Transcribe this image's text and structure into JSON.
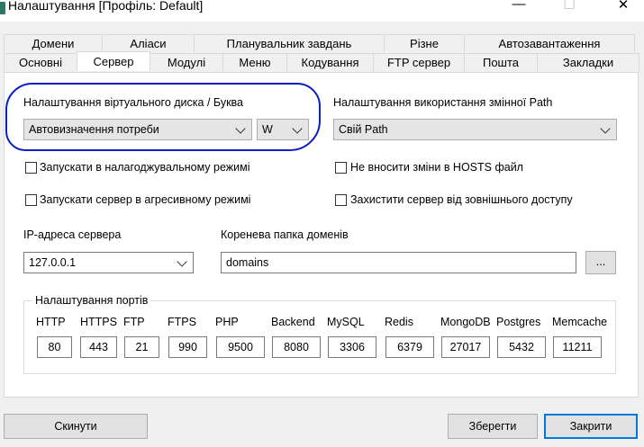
{
  "window": {
    "title": "Налаштування [Профіль: Default]",
    "minimize": "—",
    "maximize": "☐",
    "close": "✕"
  },
  "tabs_row1": [
    "Домени",
    "Аліаси",
    "Планувальник завдань",
    "Різне",
    "Автозавантаження"
  ],
  "tabs_row2": [
    "Основні",
    "Сервер",
    "Модулі",
    "Меню",
    "Кодування",
    "FTP сервер",
    "Пошта",
    "Закладки"
  ],
  "active_tab": "Сервер",
  "vdisk": {
    "label": "Налаштування віртуального диска / Буква",
    "value": "Автовизначення потреби",
    "letter": "W"
  },
  "path": {
    "label": "Налаштування використання змінної Path",
    "value": "Свій Path"
  },
  "checkboxes": {
    "debug": "Запускати в налагоджувальному режимі",
    "hosts": "Не вносити зміни в HOSTS файл",
    "aggressive": "Запускати сервер в агресивному режимі",
    "protect": "Захистити сервер від зовнішнього доступу"
  },
  "ip": {
    "label": "IP-адреса сервера",
    "value": "127.0.0.1"
  },
  "root": {
    "label": "Коренева папка доменів",
    "value": "domains",
    "browse": "..."
  },
  "ports": {
    "title": "Налаштування портів",
    "labels": [
      "HTTP",
      "HTTPS",
      "FTP",
      "FTPS",
      "PHP",
      "Backend",
      "MySQL",
      "Redis",
      "MongoDB",
      "Postgres",
      "Memcache"
    ],
    "values": [
      "80",
      "443",
      "21",
      "990",
      "9500",
      "8080",
      "3306",
      "6379",
      "27017",
      "5432",
      "11211"
    ]
  },
  "buttons": {
    "reset": "Скинути",
    "save": "Зберегти",
    "close": "Закрити"
  },
  "colors": {
    "annotation": "#0b1fc4",
    "default_button_border": "#0078d7"
  }
}
